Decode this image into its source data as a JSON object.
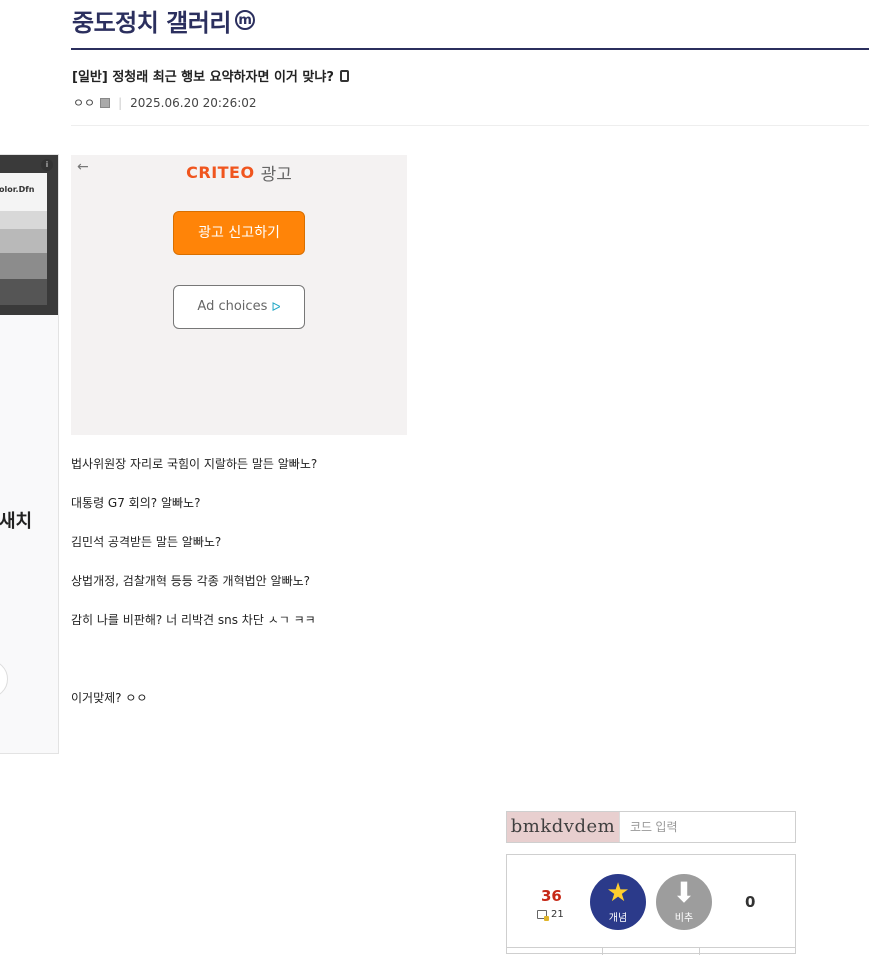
{
  "gallery": {
    "title": "중도정치 갤러리",
    "badge": "m"
  },
  "post": {
    "title": "[일반] 정청래 최근 행보 요약하자면 이거 맞냐?",
    "author": "ㅇㅇ",
    "datetime": "2025.06.20 20:26:02",
    "body": [
      "법사위원장 자리로 국힘이 지랄하든 말든 알빠노?",
      "대통령 G7 회의? 알빠노?",
      "김민석 공격받든 말든 알빠노?",
      "상법개정, 검찰개혁 등등 각종 개혁법안 알빠노?",
      "감히 나를 비판해? 너 리박견 sns 차단 ㅅㄱ ㅋㅋ",
      "이거맞제? ㅇㅇ"
    ]
  },
  "side_ad": {
    "brand_text": "olor.Dfn",
    "headline_fragment": "새치",
    "info_icon": "i"
  },
  "criteo_ad": {
    "back_icon": "←",
    "brand": "CRITEO",
    "label": "광고",
    "report_button": "광고 신고하기",
    "choices_button": "Ad choices",
    "choices_icon": "ᐅ"
  },
  "captcha": {
    "code": "bmkdvdem",
    "placeholder": "코드 입력"
  },
  "recommend": {
    "up_count": "36",
    "fixed_count": "21",
    "up_label": "개념",
    "up_icon": "★",
    "down_label": "비추",
    "down_icon": "⬇",
    "down_count": "0"
  },
  "colors": {
    "brand_navy": "#2b2f5e",
    "ad_orange": "#ff8408",
    "up_red": "#c62917"
  }
}
